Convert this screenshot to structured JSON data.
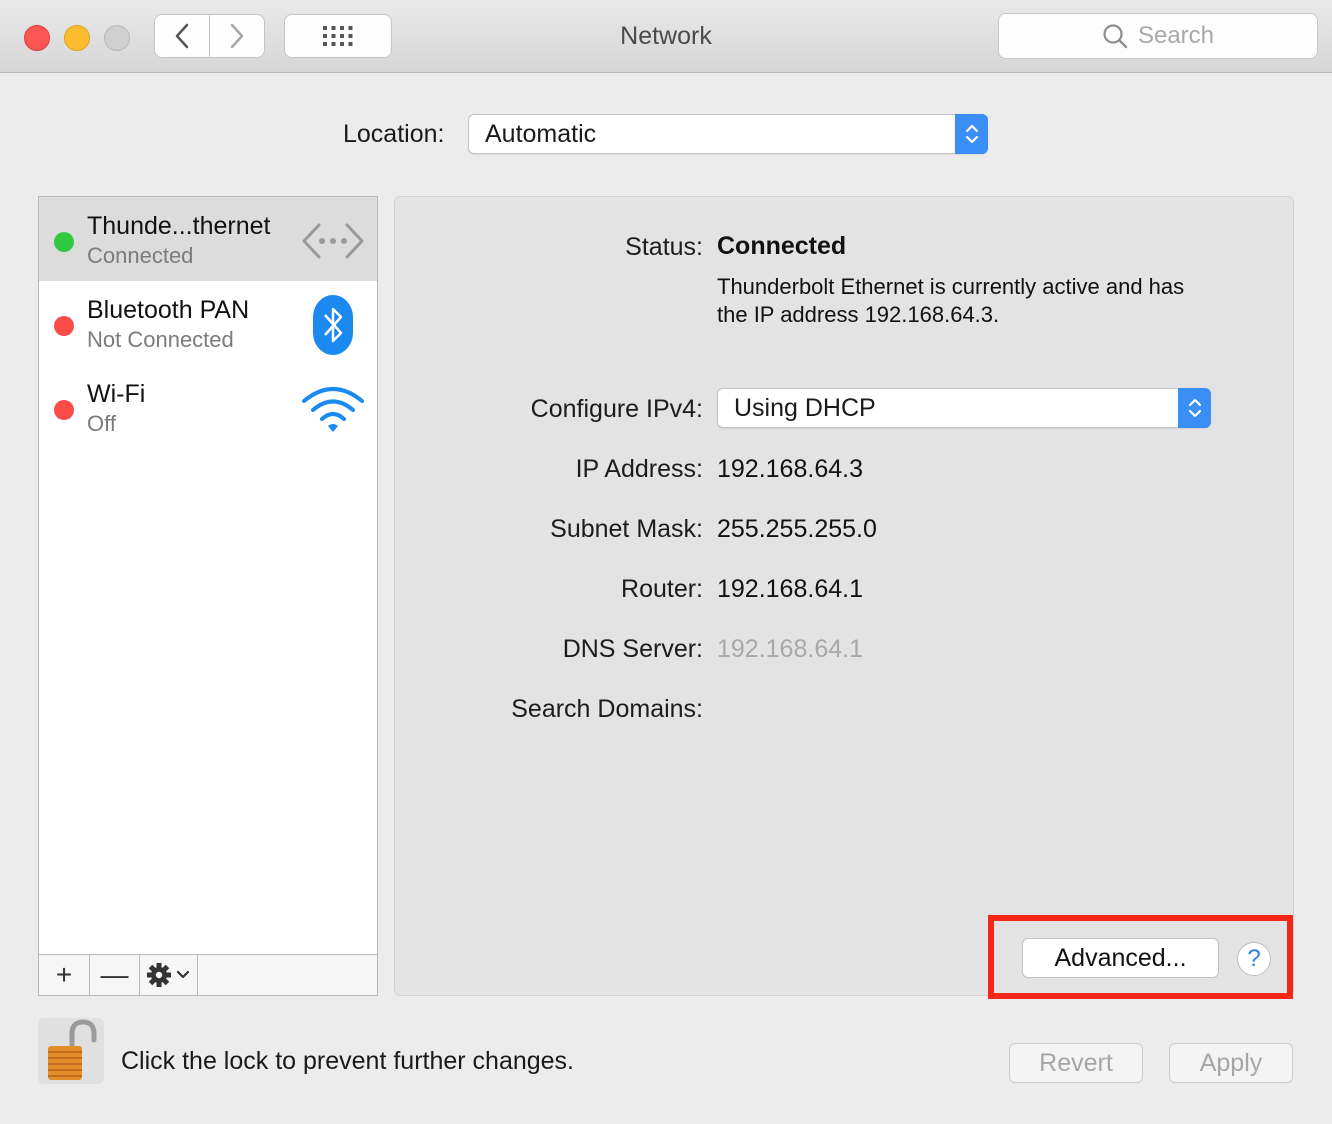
{
  "window": {
    "title": "Network",
    "search_placeholder": "Search"
  },
  "location": {
    "label": "Location:",
    "value": "Automatic"
  },
  "services": [
    {
      "name": "Thunde...thernet",
      "status": "Connected",
      "dot_color": "#2fc840",
      "icon": "ethernet-icon",
      "selected": true
    },
    {
      "name": "Bluetooth PAN",
      "status": "Not Connected",
      "dot_color": "#fb4c4a",
      "icon": "bluetooth-icon",
      "selected": false
    },
    {
      "name": "Wi-Fi",
      "status": "Off",
      "dot_color": "#fb4c4a",
      "icon": "wifi-icon",
      "selected": false
    }
  ],
  "sidebar_toolbar": {
    "add": "+",
    "remove": "—"
  },
  "detail": {
    "status_label": "Status:",
    "status_value": "Connected",
    "status_desc": "Thunderbolt Ethernet is currently active and has the IP address 192.168.64.3.",
    "configure_label": "Configure IPv4:",
    "configure_value": "Using DHCP",
    "ip_label": "IP Address:",
    "ip_value": "192.168.64.3",
    "subnet_label": "Subnet Mask:",
    "subnet_value": "255.255.255.0",
    "router_label": "Router:",
    "router_value": "192.168.64.1",
    "dns_label": "DNS Server:",
    "dns_value": "192.168.64.1",
    "search_domains_label": "Search Domains:",
    "advanced_label": "Advanced...",
    "help_label": "?"
  },
  "footer": {
    "lock_text": "Click the lock to prevent further changes.",
    "revert_label": "Revert",
    "apply_label": "Apply"
  },
  "colors": {
    "accent": "#3b8ef5",
    "highlight": "#f32618"
  }
}
